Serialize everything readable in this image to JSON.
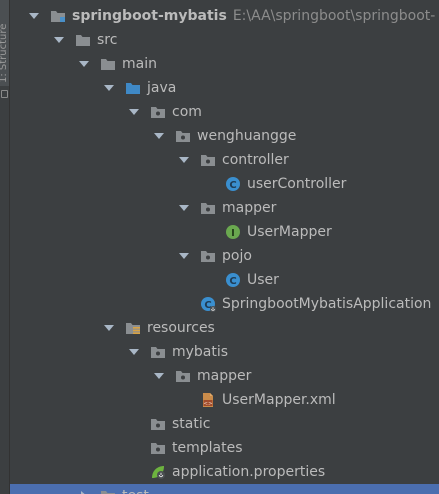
{
  "sidebar": {
    "label": "1: Structure"
  },
  "tree": [
    {
      "label": "springboot-mybatis",
      "path": "E:\\AA\\springboot\\springboot-",
      "icon": "project-folder-icon",
      "expanded": true,
      "bold": true
    },
    {
      "label": "src",
      "icon": "folder-icon",
      "expanded": true
    },
    {
      "label": "main",
      "icon": "folder-icon",
      "expanded": true
    },
    {
      "label": "java",
      "icon": "source-folder-icon",
      "expanded": true
    },
    {
      "label": "com",
      "icon": "package-icon",
      "expanded": true
    },
    {
      "label": "wenghuangge",
      "icon": "package-icon",
      "expanded": true
    },
    {
      "label": "controller",
      "icon": "package-icon",
      "expanded": true
    },
    {
      "label": "userController",
      "icon": "class-icon",
      "letter": "C"
    },
    {
      "label": "mapper",
      "icon": "package-icon",
      "expanded": true
    },
    {
      "label": "UserMapper",
      "icon": "interface-icon",
      "letter": "I"
    },
    {
      "label": "pojo",
      "icon": "package-icon",
      "expanded": true
    },
    {
      "label": "User",
      "icon": "class-icon",
      "letter": "C"
    },
    {
      "label": "SpringbootMybatisApplication",
      "icon": "spring-boot-class-icon",
      "letter": "C"
    },
    {
      "label": "resources",
      "icon": "resources-folder-icon",
      "expanded": true
    },
    {
      "label": "mybatis",
      "icon": "package-icon",
      "expanded": true
    },
    {
      "label": "mapper",
      "icon": "package-icon",
      "expanded": true
    },
    {
      "label": "UserMapper.xml",
      "icon": "xml-file-icon"
    },
    {
      "label": "static",
      "icon": "package-icon"
    },
    {
      "label": "templates",
      "icon": "package-icon"
    },
    {
      "label": "application.properties",
      "icon": "spring-properties-icon"
    },
    {
      "label": "test",
      "icon": "folder-icon",
      "expanded": false,
      "selected": true
    }
  ]
}
